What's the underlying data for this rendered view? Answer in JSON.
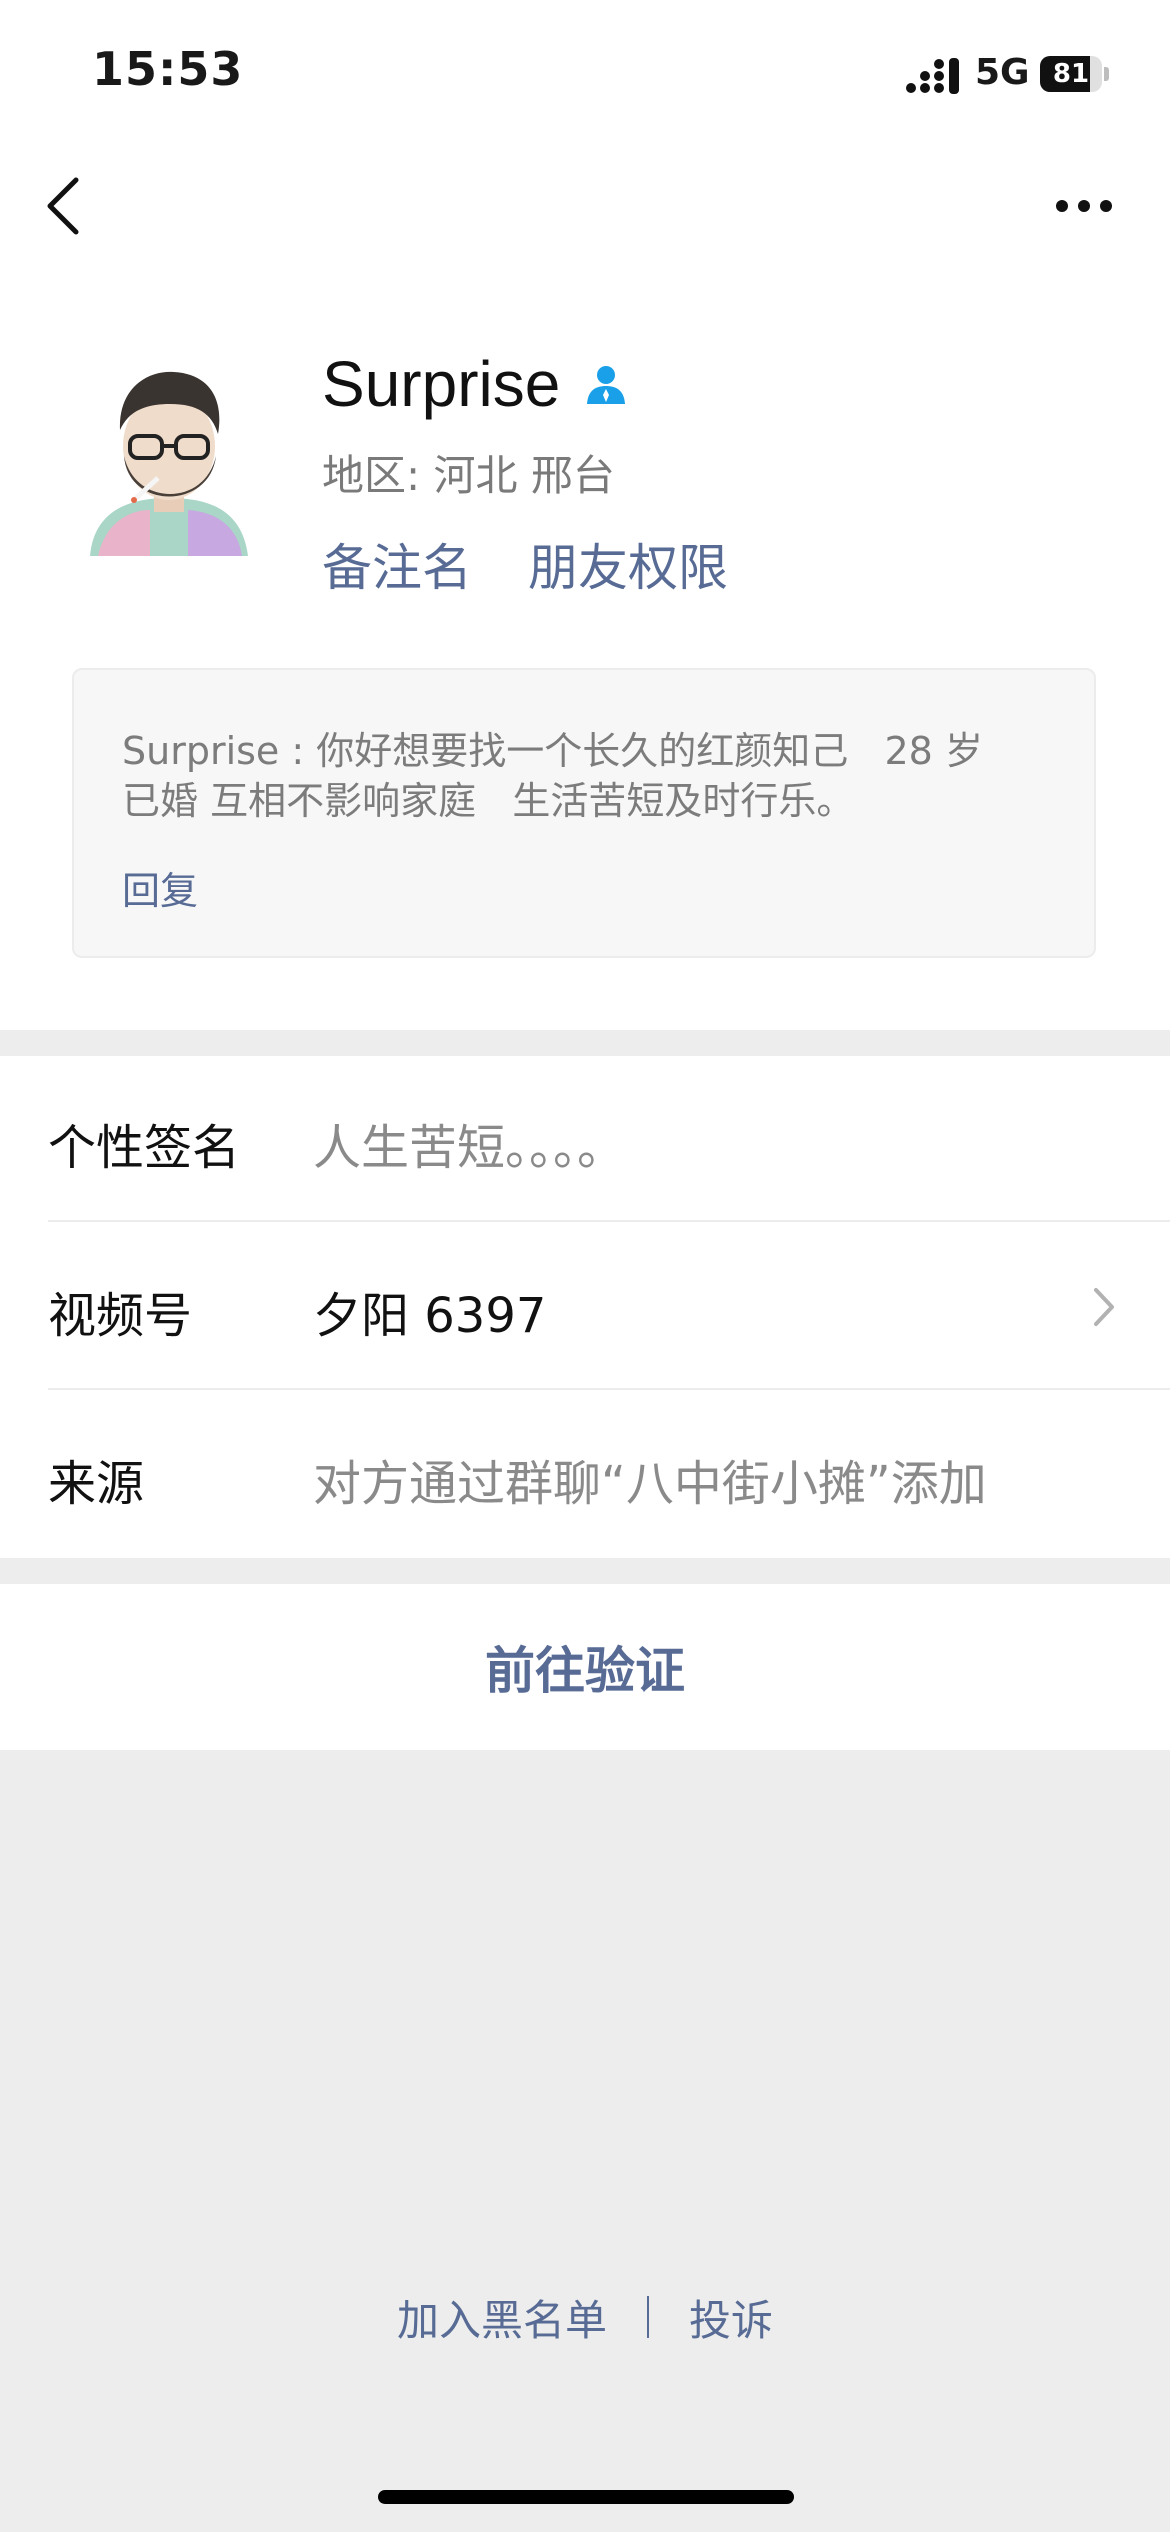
{
  "status_bar": {
    "time": "15:53",
    "network": "5G",
    "battery": "81",
    "battery_level": 0.81
  },
  "nav": {
    "back_icon": "chevron-left-icon",
    "more_icon": "more-dots-icon"
  },
  "profile": {
    "name": "Surprise",
    "region": "地区: 河北 邢台",
    "remark_label": "备注名",
    "permissions_label": "朋友权限",
    "user_badge_icon": "user-icon"
  },
  "message": {
    "text": "Surprise : 你好想要找一个长久的红颜知己   28 岁\n已婚 互相不影响家庭   生活苦短及时行乐。",
    "reply_label": "回复"
  },
  "info_rows": [
    {
      "label": "个性签名",
      "value": "人生苦短。。。。"
    },
    {
      "label": "视频号",
      "value": "夕阳 6397"
    },
    {
      "label": "来源",
      "value": "对方通过群聊“八中街小摊”添加"
    }
  ],
  "verify_button": "前往验证",
  "footer": {
    "blacklist": "加入黑名单",
    "report": "投诉"
  },
  "colors": {
    "link": "#576b95",
    "badge": "#1aa0e8",
    "page_bg": "#ededed"
  }
}
